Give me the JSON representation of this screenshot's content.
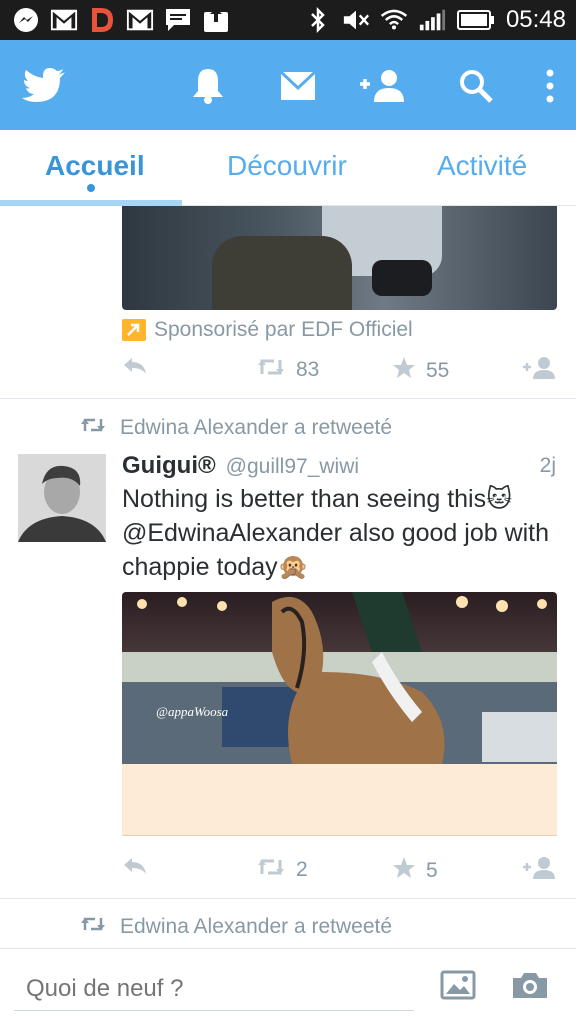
{
  "status_bar": {
    "time": "05:48",
    "left_icons": [
      "messenger-icon",
      "gmail-icon",
      "d-app-icon",
      "gmail-icon",
      "message-icon",
      "photo-upload-icon"
    ],
    "right_icons": [
      "bluetooth-icon",
      "mute-icon",
      "wifi-icon",
      "signal-icon",
      "battery-icon"
    ]
  },
  "app_bar": {
    "icons": [
      "twitter-bird-icon",
      "notifications-bell-icon",
      "messages-envelope-icon",
      "add-user-icon",
      "search-icon",
      "overflow-menu-icon"
    ],
    "brand_color": "#55acee"
  },
  "tabs": [
    {
      "label": "Accueil",
      "active": true
    },
    {
      "label": "Découvrir",
      "active": false
    },
    {
      "label": "Activité",
      "active": false
    }
  ],
  "feed": {
    "promoted_tweet": {
      "sponsor_text": "Sponsorisé par EDF Officiel",
      "retweets": "83",
      "favorites": "55"
    },
    "tweet": {
      "retweeted_by": "Edwina Alexander a retweeté",
      "name": "Guigui®",
      "handle": "@guill97_wiwi",
      "time": "2j",
      "text_line1": "Nothing is better than seeing this🐱",
      "text_line2": "@EdwinaAlexander also good job with",
      "text_line3": "chappie today🙊",
      "image_watermark": "@appaWoosa",
      "retweets": "2",
      "favorites": "5"
    },
    "next_tweet": {
      "retweeted_by": "Edwina Alexander a retweeté"
    }
  },
  "compose": {
    "placeholder": "Quoi de neuf ?"
  }
}
